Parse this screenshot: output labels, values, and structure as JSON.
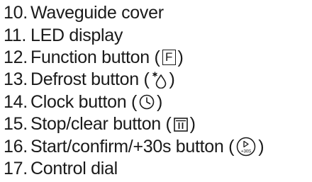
{
  "items": [
    {
      "number": "10.",
      "label": "Waveguide cover"
    },
    {
      "number": "11.",
      "label": "LED display"
    },
    {
      "number": "12.",
      "label": "Function button (",
      "close": ")",
      "symbol_text": "F",
      "icon": "function-f-box-icon"
    },
    {
      "number": "13.",
      "label": "Defrost button (",
      "close": ")",
      "icon": "snowflake-drop-icon"
    },
    {
      "number": "14.",
      "label": "Clock button (",
      "close": ")",
      "icon": "clock-icon"
    },
    {
      "number": "15.",
      "label": "Stop/clear button (",
      "close": ")",
      "icon": "stop-clear-box-icon"
    },
    {
      "number": "16.",
      "label": "Start/confirm/+30s button (",
      "close": ")",
      "symbol_text": "+30S",
      "icon": "start-play-circle-icon"
    },
    {
      "number": "17.",
      "label": "Control dial"
    }
  ],
  "colors": {
    "text": "#1a1a1a",
    "background": "#ffffff"
  }
}
